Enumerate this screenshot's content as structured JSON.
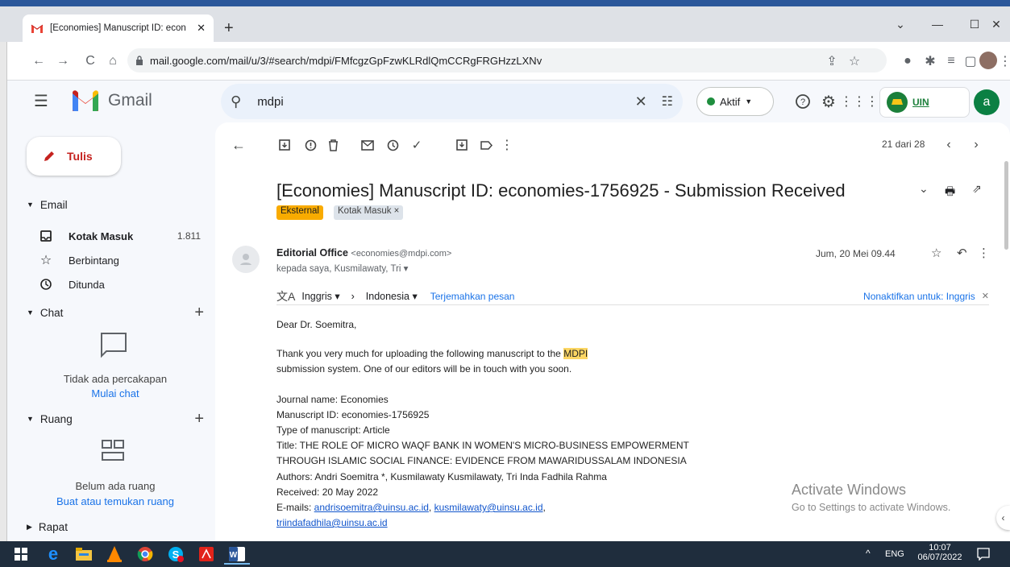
{
  "browser": {
    "tab_title": "[Economies] Manuscript ID: econ",
    "url": "mail.google.com/mail/u/3/#search/mdpi/FMfcgzGpFzwKLRdlQmCCRgFRGHzzLXNv",
    "new_tab": "+",
    "nav": {
      "back": "←",
      "forward": "→",
      "reload": "C",
      "home": "⌂"
    }
  },
  "gmail": {
    "logo_text": "Gmail",
    "search_value": "mdpi",
    "status_label": "Aktif",
    "account_initial": "a",
    "org_badge": "UIN"
  },
  "sidebar": {
    "compose": "Tulis",
    "email_section": "Email",
    "items": [
      {
        "label": "Kotak Masuk",
        "count": "1.811"
      },
      {
        "label": "Berbintang",
        "count": ""
      },
      {
        "label": "Ditunda",
        "count": ""
      }
    ],
    "chat_section": "Chat",
    "chat_empty": "Tidak ada percakapan",
    "chat_start": "Mulai chat",
    "rooms_section": "Ruang",
    "rooms_empty": "Belum ada ruang",
    "rooms_action": "Buat atau temukan ruang",
    "meet_section": "Rapat"
  },
  "toolbar": {
    "pagination": "21 dari 28"
  },
  "message": {
    "subject": "[Economies] Manuscript ID: economies-1756925 - Submission Received",
    "label_external": "Eksternal",
    "label_inbox": "Kotak Masuk ×",
    "sender_name": "Editorial Office",
    "sender_email": "<economies@mdpi.com>",
    "recipients": "kepada saya, Kusmilawaty, Tri ▾",
    "date": "Jum, 20 Mei 09.44",
    "translate": {
      "from": "Inggris ▾",
      "to": "Indonesia ▾",
      "action": "Terjemahkan pesan",
      "disable": "Nonaktifkan untuk: Inggris"
    },
    "greeting": "Dear Dr. Soemitra,",
    "para1_before": "Thank you very much for uploading the following manuscript to the ",
    "para1_highlight": "MDPI",
    "para1_line2": "submission system. One of our editors will be in touch with you soon.",
    "journal": "Journal name: Economies",
    "manuscript_id": "Manuscript ID: economies-1756925",
    "type": "Type of manuscript: Article",
    "title_line1": "Title: THE ROLE OF MICRO WAQF BANK IN WOMEN'S MICRO-BUSINESS EMPOWERMENT",
    "title_line2": "THROUGH ISLAMIC SOCIAL FINANCE: EVIDENCE FROM MAWARIDUSSALAM INDONESIA",
    "authors": "Authors: Andri Soemitra *, Kusmilawaty Kusmilawaty, Tri Inda Fadhila Rahma",
    "received": "Received: 20 May 2022",
    "emails_label": "E-mails: ",
    "email1": "andrisoemitra@uinsu.ac.id",
    "email2": "kusmilawaty@uinsu.ac.id",
    "email3": "triindafadhila@uinsu.ac.id"
  },
  "watermark": {
    "title": "Activate Windows",
    "subtitle": "Go to Settings to activate Windows."
  },
  "taskbar": {
    "lang": "ENG",
    "time": "10:07",
    "date": "06/07/2022",
    "tray_arrow": "^"
  },
  "colors": {
    "gmail_bg": "#f6f8fc",
    "search_bg": "#eaf1fb",
    "compose_red": "#c5221f",
    "link_blue": "#1a73e8",
    "label_external": "#f9ab00",
    "taskbar": "#1f2d3d"
  }
}
